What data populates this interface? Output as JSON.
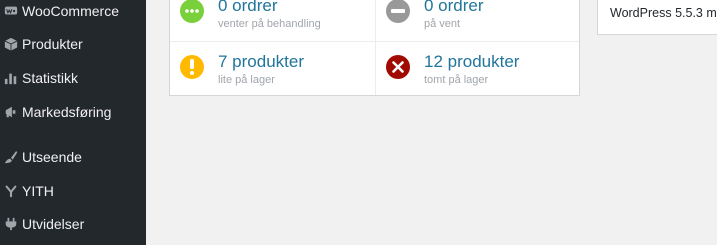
{
  "sidebar": {
    "items": [
      {
        "label": "WooCommerce",
        "icon": "woocommerce-icon"
      },
      {
        "label": "Produkter",
        "icon": "products-box-icon"
      },
      {
        "label": "Statistikk",
        "icon": "bar-chart-icon"
      },
      {
        "label": "Markedsføring",
        "icon": "megaphone-icon"
      },
      {
        "label": "Utseende",
        "icon": "paintbrush-icon"
      },
      {
        "label": "YITH",
        "icon": "yith-icon"
      },
      {
        "label": "Utvidelser",
        "icon": "plugin-icon"
      }
    ]
  },
  "status": {
    "pending": {
      "count": "0 ordrer",
      "caption": "venter på behandling",
      "color": "#7ad03a",
      "icon": "ellipsis-icon"
    },
    "on_hold": {
      "count": "0 ordrer",
      "caption": "på vent",
      "color": "#999999",
      "icon": "minus-icon"
    },
    "low_stock": {
      "count": "7 produkter",
      "caption": "lite på lager",
      "color": "#ffba00",
      "icon": "exclamation-icon"
    },
    "out_of_stock": {
      "count": "12 produkter",
      "caption": "tomt på lager",
      "color": "#a00a00",
      "icon": "x-icon"
    }
  },
  "right_panel": {
    "version_text": "WordPress 5.5.3 m"
  }
}
